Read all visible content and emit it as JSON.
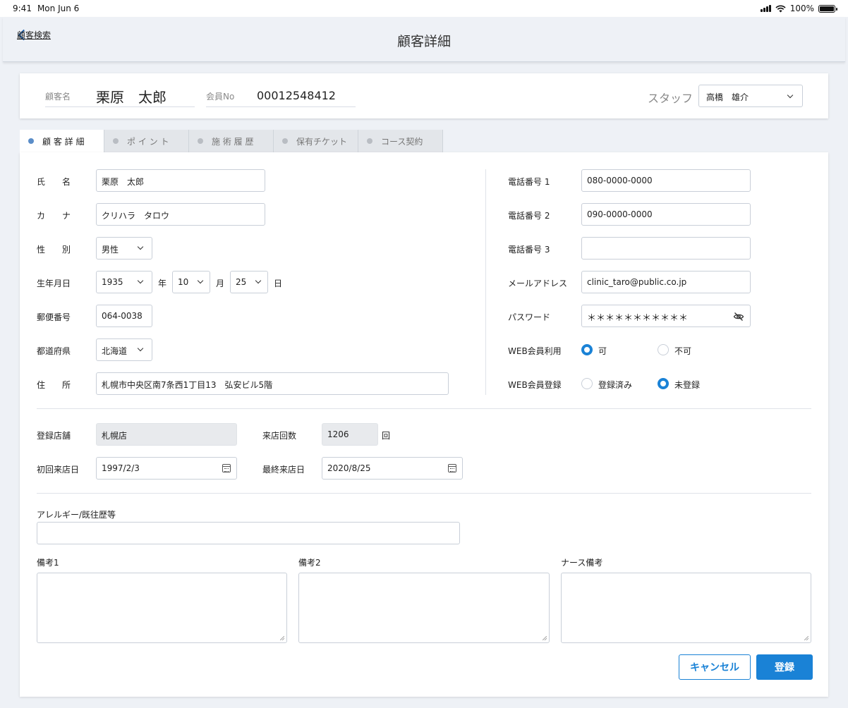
{
  "status": {
    "time": "9:41",
    "date": "Mon Jun 6",
    "battery": "100%"
  },
  "nav": {
    "back_label": "顧客検索",
    "title": "顧客詳細"
  },
  "header": {
    "customer_name_label": "顧客名",
    "customer_name": "栗原　太郎",
    "member_no_label": "会員No",
    "member_no": "00012548412",
    "staff_label": "スタッフ",
    "staff_value": "高橋　雄介"
  },
  "tabs": [
    {
      "label": "顧 客 詳 細",
      "active": true
    },
    {
      "label": "ポ イ ン ト",
      "active": false
    },
    {
      "label": "施 術 履 歴",
      "active": false
    },
    {
      "label": "保有チケット",
      "active": false
    },
    {
      "label": "コース契約",
      "active": false
    }
  ],
  "form": {
    "name_label": "氏　　名",
    "name_value": "栗原　太郎",
    "kana_label": "カ　　ナ",
    "kana_value": "クリハラ　タロウ",
    "gender_label": "性　　別",
    "gender_value": "男性",
    "birth_label": "生年月日",
    "birth_year": "1935",
    "birth_year_unit": "年",
    "birth_month": "10",
    "birth_month_unit": "月",
    "birth_day": "25",
    "birth_day_unit": "日",
    "zip_label": "郵便番号",
    "zip_value": "064-0038",
    "pref_label": "都道府県",
    "pref_value": "北海道",
    "address_label": "住　　所",
    "address_value": "札幌市中央区南7条西1丁目13　弘安ビル5階",
    "phone1_label": "電話番号 1",
    "phone1_value": "080-0000-0000",
    "phone2_label": "電話番号 2",
    "phone2_value": "090-0000-0000",
    "phone3_label": "電話番号 3",
    "phone3_value": "",
    "email_label": "メールアドレス",
    "email_value": "clinic_taro@public.co.jp",
    "password_label": "パスワード",
    "password_value": "＊＊＊＊＊＊＊＊＊＊＊",
    "web_use_label": "WEB会員利用",
    "web_use_options": [
      "可",
      "不可"
    ],
    "web_use_selected": 0,
    "web_reg_label": "WEB会員登録",
    "web_reg_options": [
      "登録済み",
      "未登録"
    ],
    "web_reg_selected": 1,
    "store_label": "登録店舗",
    "store_value": "札幌店",
    "visits_label": "来店回数",
    "visits_value": "1206",
    "visits_unit": "回",
    "first_visit_label": "初回来店日",
    "first_visit_value": "1997/2/3",
    "last_visit_label": "最終来店日",
    "last_visit_value": "2020/8/25",
    "allergy_label": "アレルギー/既往歴等",
    "allergy_value": "",
    "note1_label": "備考1",
    "note2_label": "備考2",
    "nurse_note_label": "ナース備考"
  },
  "buttons": {
    "cancel": "キャンセル",
    "submit": "登録"
  },
  "colors": {
    "accent": "#1a82d6",
    "link": "#1f63b0",
    "background": "#eef1f6"
  }
}
